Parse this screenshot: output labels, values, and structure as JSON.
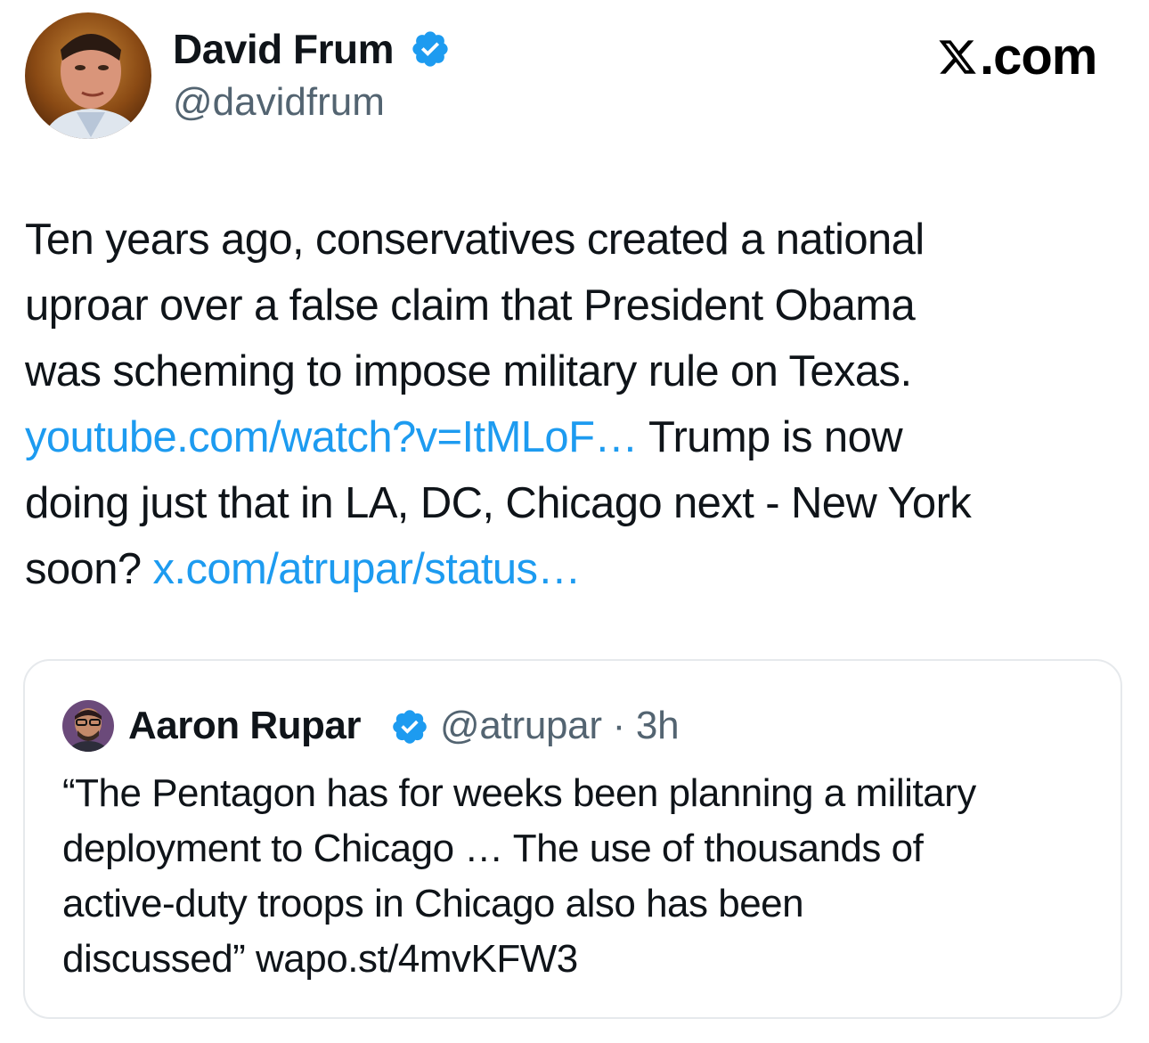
{
  "author": {
    "display_name": "David Frum",
    "handle": "@davidfrum",
    "verified": true,
    "avatar_icon": "profile-photo"
  },
  "brand": {
    "text": ".com",
    "icon": "x-logo-icon"
  },
  "tweet": {
    "lines": [
      [
        {
          "text": "Ten years ago, conservatives created a national"
        }
      ],
      [
        {
          "text": "uproar over a false claim that President Obama"
        }
      ],
      [
        {
          "text": "was scheming to impose military rule on Texas."
        }
      ],
      [
        {
          "text": "youtube.com/watch?v=ItMLoF…",
          "link": true
        },
        {
          "text": " Trump is now"
        }
      ],
      [
        {
          "text": "doing just that in LA, DC, Chicago next - New York"
        }
      ],
      [
        {
          "text": "soon? "
        },
        {
          "text": "x.com/atrupar/status…",
          "link": true
        }
      ]
    ]
  },
  "quote": {
    "display_name": "Aaron Rupar",
    "handle": "@atrupar",
    "separator": "·",
    "time": "3h",
    "verified": true,
    "lines": [
      "“The Pentagon has for weeks been planning a military",
      "deployment to Chicago … The use of thousands of",
      "active-duty troops in Chicago also has been",
      "discussed” wapo.st/4mvKFW3"
    ]
  },
  "colors": {
    "text": "#0f1419",
    "secondary": "#536471",
    "link": "#1d9bf0",
    "verified": "#1d9bf0",
    "card_border": "#e6e9ec"
  }
}
